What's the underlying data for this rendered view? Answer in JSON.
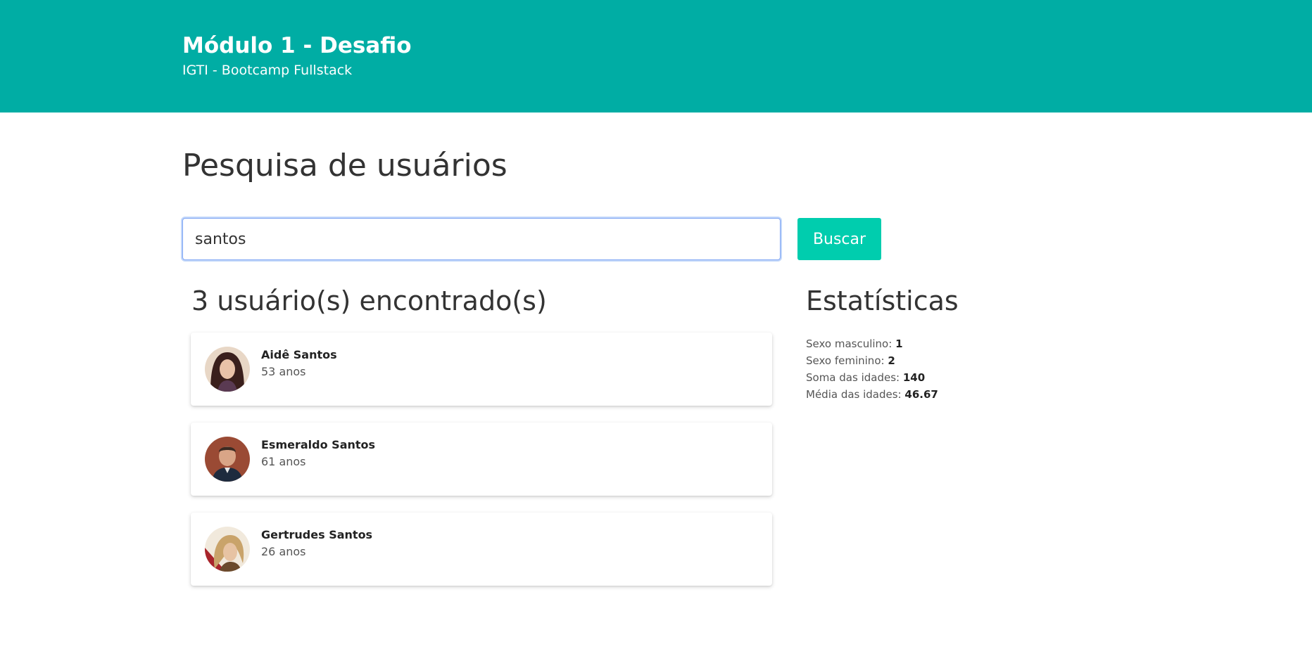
{
  "header": {
    "title": "Módulo 1 - Desafio",
    "subtitle": "IGTI - Bootcamp Fullstack",
    "color": "#00ADA4"
  },
  "page": {
    "title": "Pesquisa de usuários"
  },
  "search": {
    "value": "santos",
    "button_label": "Buscar",
    "button_color": "#00CDAE"
  },
  "results": {
    "title": "3 usuário(s) encontrado(s)",
    "users": [
      {
        "name": "Aidê Santos",
        "age": "53 anos",
        "avatar": "female-avatar"
      },
      {
        "name": "Esmeraldo Santos",
        "age": "61 anos",
        "avatar": "male-avatar"
      },
      {
        "name": "Gertrudes Santos",
        "age": "26 anos",
        "avatar": "female-avatar"
      }
    ]
  },
  "stats": {
    "title": "Estatísticas",
    "items": [
      {
        "label": "Sexo masculino: ",
        "value": "1"
      },
      {
        "label": "Sexo feminino: ",
        "value": "2"
      },
      {
        "label": "Soma das idades: ",
        "value": "140"
      },
      {
        "label": "Média das idades: ",
        "value": "46.67"
      }
    ]
  }
}
